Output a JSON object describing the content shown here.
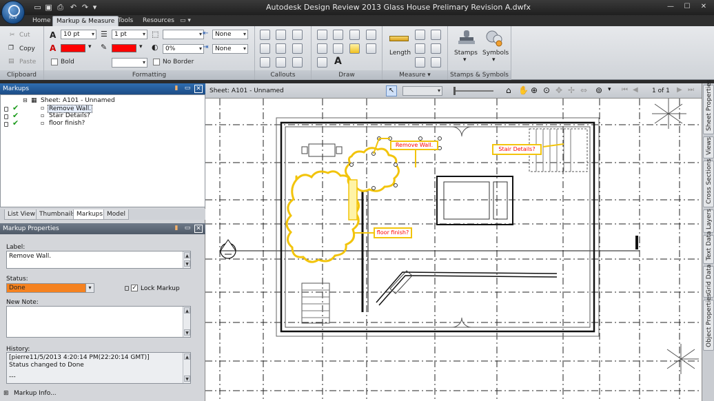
{
  "app": {
    "title": "Autodesk Design Review 2013    Glass House Prelimary Revision A.dwfx",
    "app_button_label": "REV"
  },
  "tabs": [
    {
      "label": "Home"
    },
    {
      "label": "Markup & Measure"
    },
    {
      "label": "Tools"
    },
    {
      "label": "Resources"
    }
  ],
  "ribbon": {
    "clipboard": {
      "label": "Clipboard",
      "cut": "Cut",
      "copy": "Copy",
      "paste": "Paste"
    },
    "formatting": {
      "label": "Formatting",
      "font_size": "10 pt",
      "line_weight": "1 pt",
      "fill_opacity": "0%",
      "arrow_start": "None",
      "arrow_end": "None",
      "bold": "Bold",
      "no_border": "No Border",
      "color_red": "#ff0000"
    },
    "callouts": {
      "label": "Callouts"
    },
    "draw": {
      "label": "Draw"
    },
    "measure": {
      "label": "Measure",
      "length": "Length"
    },
    "stamps": {
      "label": "Stamps & Symbols",
      "stamps": "Stamps",
      "symbols": "Symbols"
    }
  },
  "markups_panel": {
    "title": "Markups",
    "sheet": "Sheet: A101 - Unnamed",
    "items": [
      {
        "label": "Remove Wall."
      },
      {
        "label": "Stair Details?"
      },
      {
        "label": "floor finish?"
      }
    ],
    "tabs": [
      {
        "label": "List View"
      },
      {
        "label": "Thumbnails"
      },
      {
        "label": "Markups"
      },
      {
        "label": "Model"
      }
    ]
  },
  "properties": {
    "title": "Markup Properties",
    "label_caption": "Label:",
    "label_value": "Remove Wall.",
    "status_caption": "Status:",
    "status_value": "Done",
    "status_color": "#f58220",
    "lock_label": "Lock Markup",
    "new_note_caption": "New Note:",
    "history_caption": "History:",
    "history_line1": "[pierre11/5/2013 4:20:14 PM(22:20:14 GMT)]",
    "history_line2": "Status changed to Done",
    "history_line3": "---",
    "markup_info": "Markup Info..."
  },
  "canvas": {
    "sheet_title": "Sheet: A101 - Unnamed",
    "page_of": "1 of 1",
    "callouts": [
      {
        "label": "Remove Wall."
      },
      {
        "label": "Stair Details?"
      },
      {
        "label": "floor finish?"
      }
    ],
    "markup_color": "#ff0000",
    "highlight_color": "#f2c40c"
  },
  "right_tabs": [
    {
      "label": "Sheet Properties"
    },
    {
      "label": "Views"
    },
    {
      "label": "Cross Sections"
    },
    {
      "label": "Layers"
    },
    {
      "label": "Text Data"
    },
    {
      "label": "Grid Data"
    },
    {
      "label": "Object Properties"
    }
  ]
}
